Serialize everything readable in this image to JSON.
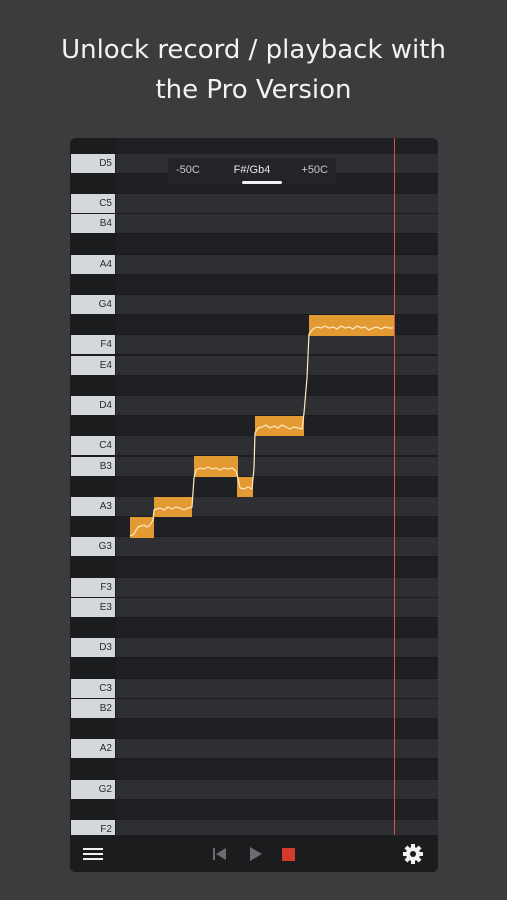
{
  "promo": {
    "line1": "Unlock record / playback with",
    "line2": "the Pro Version"
  },
  "tuner": {
    "left_label": "-50C",
    "center_label": "F#/Gb4",
    "right_label": "+50C"
  },
  "keys": {
    "d5": "D5",
    "c5": "C5",
    "b4": "B4",
    "a4": "A4",
    "g4": "G4",
    "f4": "F4",
    "e4": "E4",
    "d4": "D4",
    "c4": "C4",
    "b3": "B3",
    "a3": "A3",
    "g3": "G3",
    "f3": "F3",
    "e3": "E3",
    "d3": "D3",
    "c3": "C3",
    "b2": "B2",
    "a2": "A2",
    "g2": "G2",
    "f2": "F2"
  },
  "colors": {
    "note_fill": "#e39a32",
    "pitch_line": "#ffe9c4",
    "playhead": "#d9533c",
    "stop": "#d33c2c"
  },
  "toolbar": {
    "menu_icon": "hamburger-menu-icon",
    "rewind_icon": "skip-back-icon",
    "play_icon": "play-icon",
    "stop_icon": "stop-icon",
    "settings_icon": "gear-icon"
  }
}
